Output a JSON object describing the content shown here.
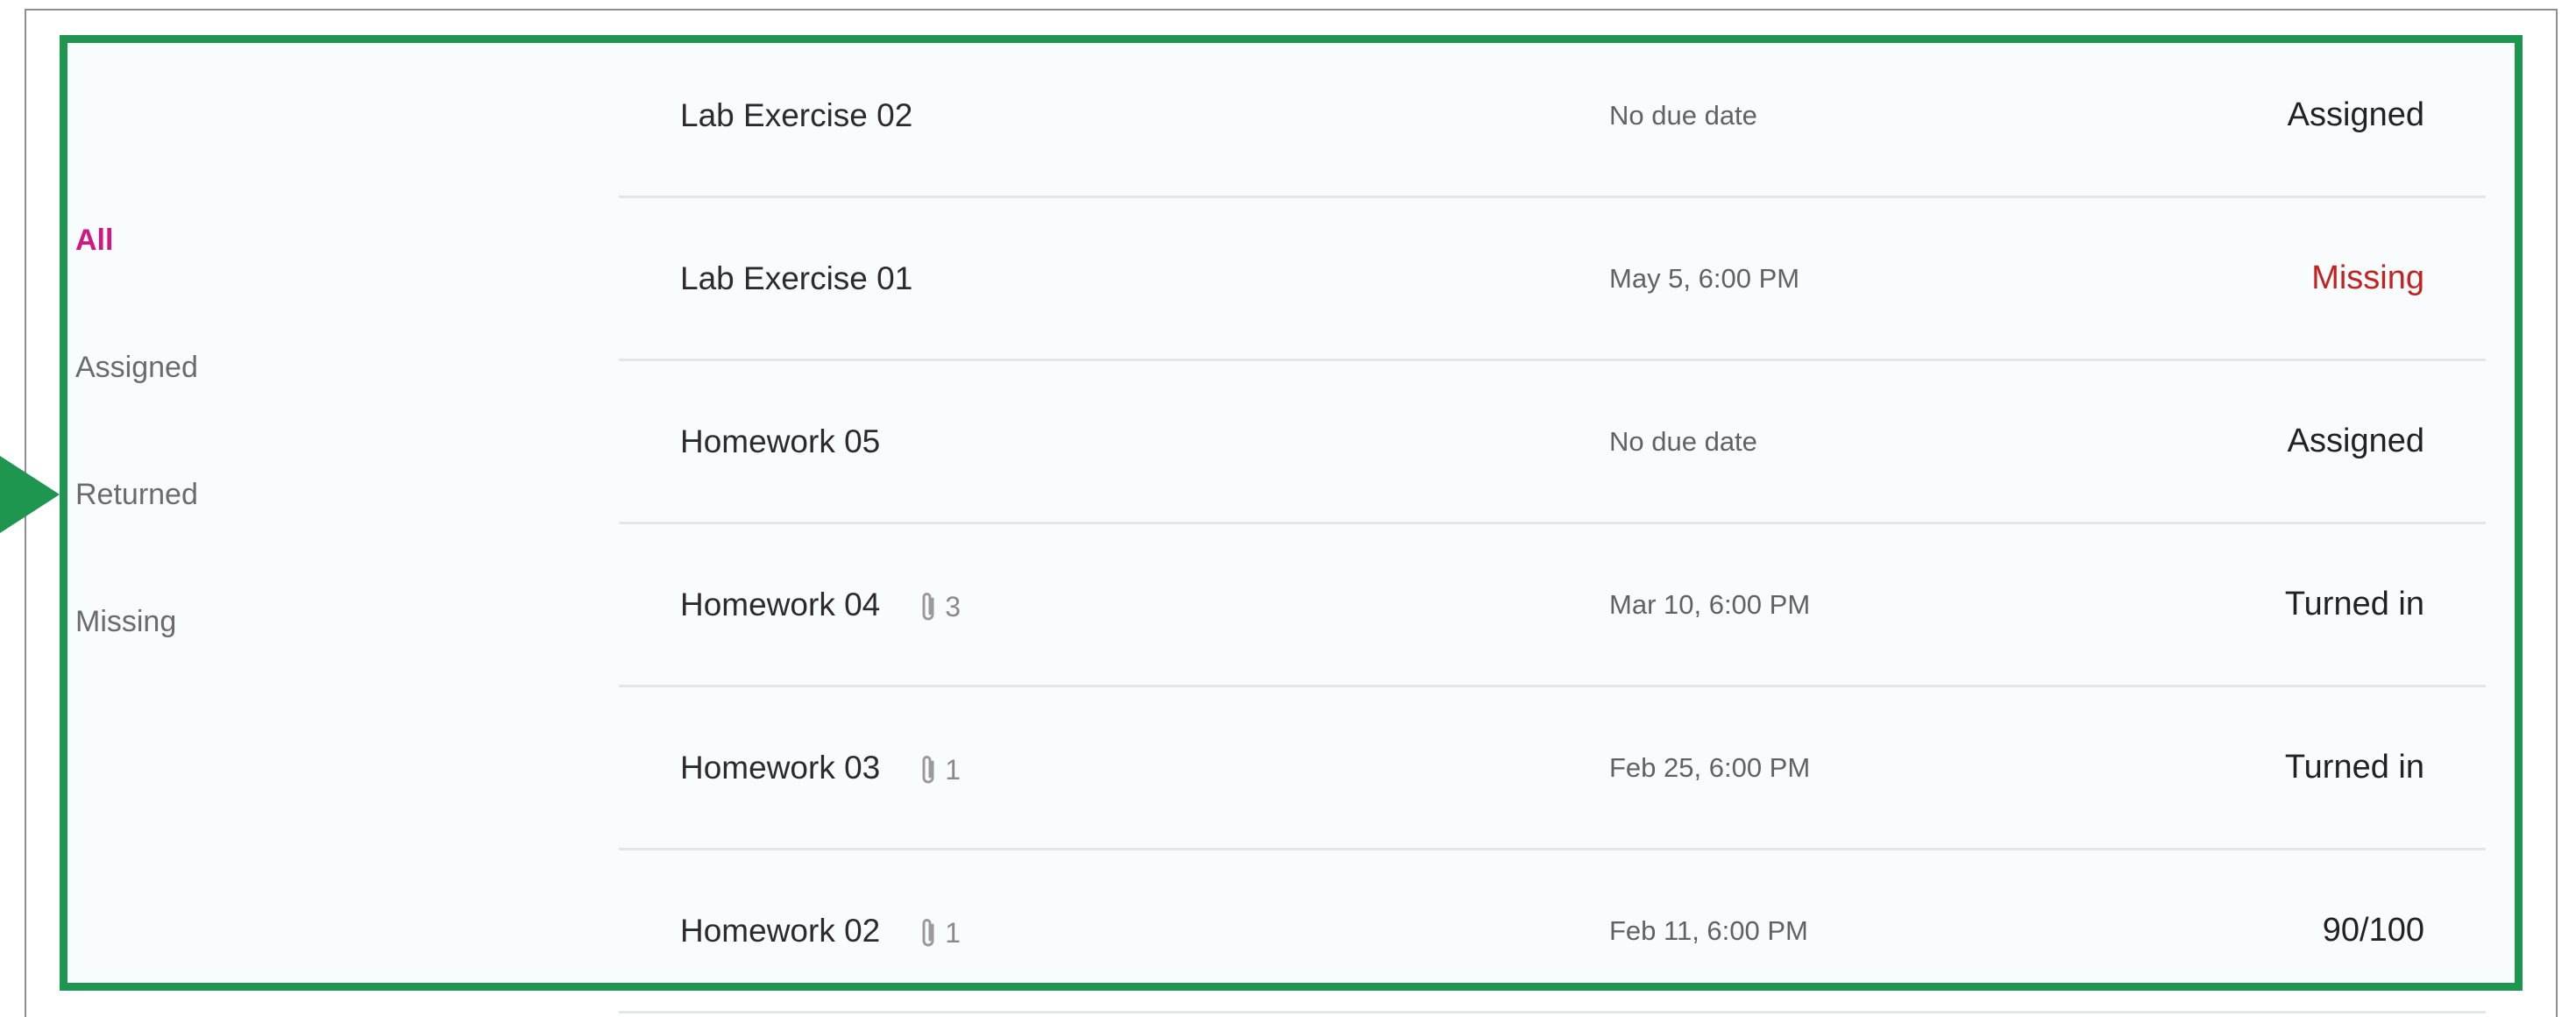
{
  "filters": {
    "items": [
      {
        "label": "All",
        "active": true
      },
      {
        "label": "Assigned",
        "active": false
      },
      {
        "label": "Returned",
        "active": false
      },
      {
        "label": "Missing",
        "active": false
      }
    ]
  },
  "assignments": [
    {
      "title": "Lab Exercise 02",
      "attachments": "",
      "due": "No due date",
      "status": "Assigned"
    },
    {
      "title": "Lab Exercise 01",
      "attachments": "",
      "due": "May 5, 6:00 PM",
      "status": "Missing"
    },
    {
      "title": "Homework 05",
      "attachments": "",
      "due": "No due date",
      "status": "Assigned"
    },
    {
      "title": "Homework 04",
      "attachments": "3",
      "due": "Mar 10, 6:00 PM",
      "status": "Turned in"
    },
    {
      "title": "Homework 03",
      "attachments": "1",
      "due": "Feb 25, 6:00 PM",
      "status": "Turned in"
    },
    {
      "title": "Homework 02",
      "attachments": "1",
      "due": "Feb 11, 6:00 PM",
      "status": "90/100"
    }
  ],
  "colors": {
    "active_filter": "#d01784",
    "missing": "#c5221f",
    "highlight": "#1e9650",
    "icon": "paperclip-icon"
  }
}
